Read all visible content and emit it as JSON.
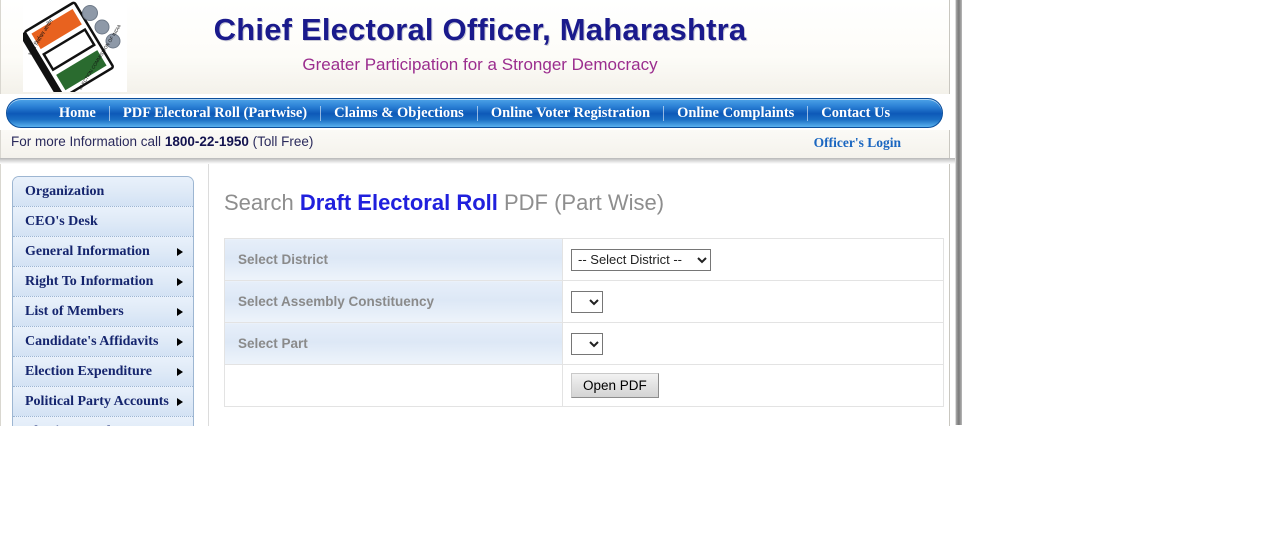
{
  "header": {
    "title": "Chief Electoral Officer, Maharashtra",
    "tagline": "Greater Participation for a Stronger Democracy",
    "logo_icon": "election-commission-of-india-logo",
    "title_color": "#1a1a8c",
    "tagline_color": "#9b2d8e"
  },
  "nav": {
    "items": [
      {
        "label": "Home"
      },
      {
        "label": "PDF Electoral Roll (Partwise)"
      },
      {
        "label": "Claims & Objections"
      },
      {
        "label": "Online Voter Registration"
      },
      {
        "label": "Online Complaints"
      },
      {
        "label": "Contact Us"
      }
    ],
    "bar_color": "#0d59b8"
  },
  "info_strip": {
    "prefix": "For more Information call",
    "phone": "1800-22-1950",
    "suffix": "(Toll Free)",
    "officers_login": "Officer's Login",
    "link_color": "#1a66c0"
  },
  "sidebar": {
    "items": [
      {
        "label": "Organization",
        "has_arrow": false
      },
      {
        "label": "CEO's Desk",
        "has_arrow": false
      },
      {
        "label": "General Information",
        "has_arrow": true
      },
      {
        "label": "Right To Information",
        "has_arrow": true
      },
      {
        "label": "List of Members",
        "has_arrow": true
      },
      {
        "label": "Candidate's Affidavits",
        "has_arrow": true
      },
      {
        "label": "Election Expenditure",
        "has_arrow": true
      },
      {
        "label": "Political Party Accounts",
        "has_arrow": true
      },
      {
        "label": "Election Results",
        "has_arrow": true
      }
    ]
  },
  "main": {
    "heading": {
      "part1": "Search ",
      "highlight": "Draft Electoral Roll",
      "part2": " PDF (Part Wise)",
      "highlight_color": "#2020dd",
      "plain_color": "#8e8e8e"
    },
    "form": {
      "rows": [
        {
          "label": "Select District",
          "control": "select",
          "selected": "-- Select District --",
          "options": [
            "-- Select District --"
          ]
        },
        {
          "label": "Select Assembly Constituency",
          "control": "select",
          "selected": "",
          "options": [
            ""
          ]
        },
        {
          "label": "Select Part",
          "control": "select",
          "selected": "",
          "options": [
            ""
          ]
        },
        {
          "label": "",
          "control": "button",
          "button_label": "Open PDF"
        }
      ]
    }
  }
}
